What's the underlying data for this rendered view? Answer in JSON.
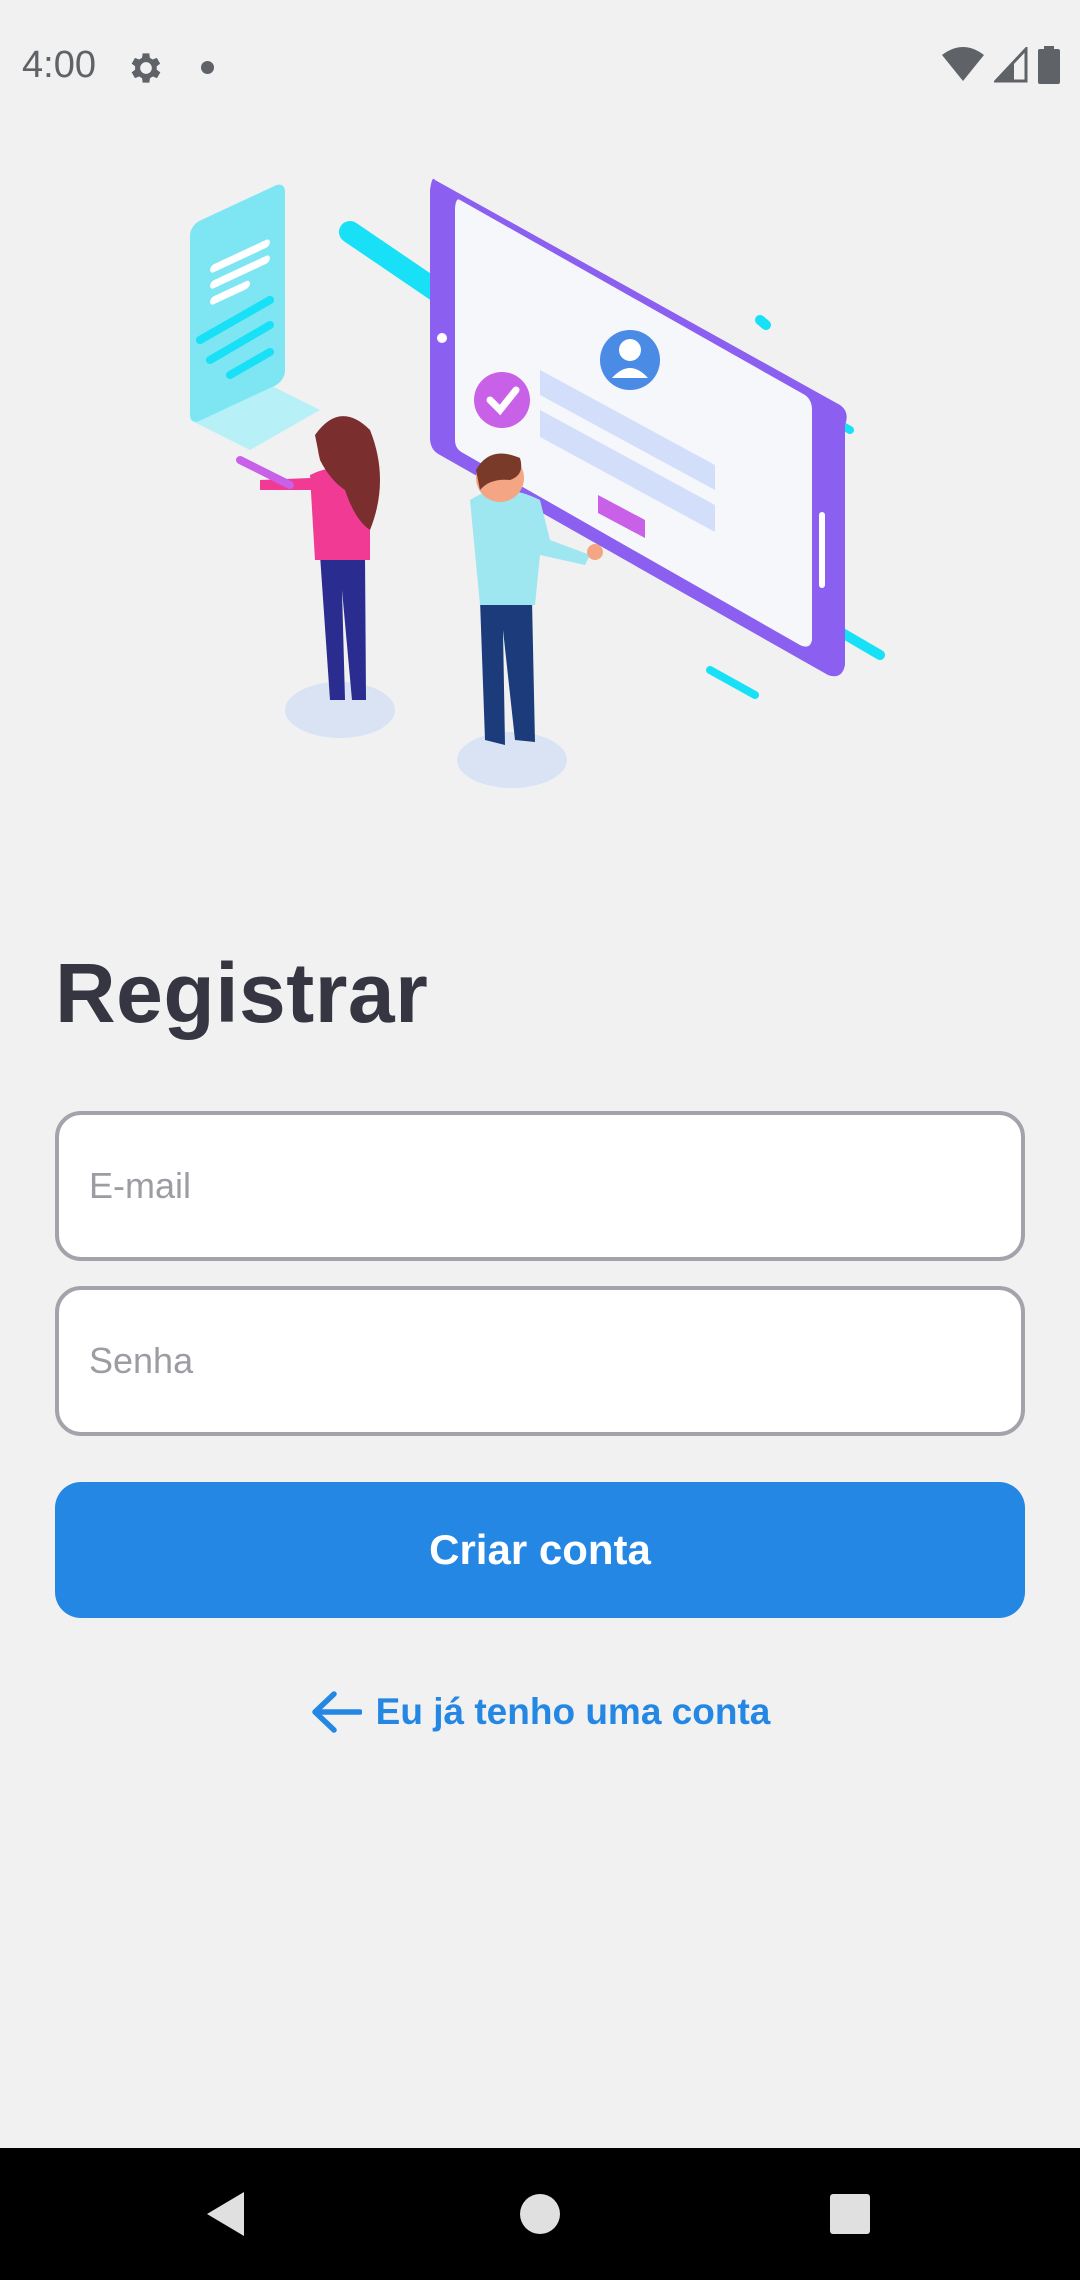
{
  "status_bar": {
    "time": "4:00",
    "icons": [
      "gear-icon",
      "notification-dot-icon",
      "wifi-icon",
      "signal-icon",
      "battery-icon"
    ],
    "text_color": "#5f6368"
  },
  "illustration": {
    "icon": "registration-illustration"
  },
  "register": {
    "title": "Registrar",
    "email_placeholder": "E-mail",
    "email_value": "",
    "password_placeholder": "Senha",
    "password_value": "",
    "create_button_label": "Criar conta",
    "login_link_label": "Eu já tenho uma conta",
    "login_link_icon": "arrow-left-icon"
  },
  "nav_bar": {
    "icons": [
      "back-icon",
      "home-icon",
      "recents-icon"
    ]
  },
  "colors": {
    "accent": "#2387e3",
    "background": "#f1f1f2",
    "title": "#353641",
    "field_border": "#a3a3ab"
  }
}
